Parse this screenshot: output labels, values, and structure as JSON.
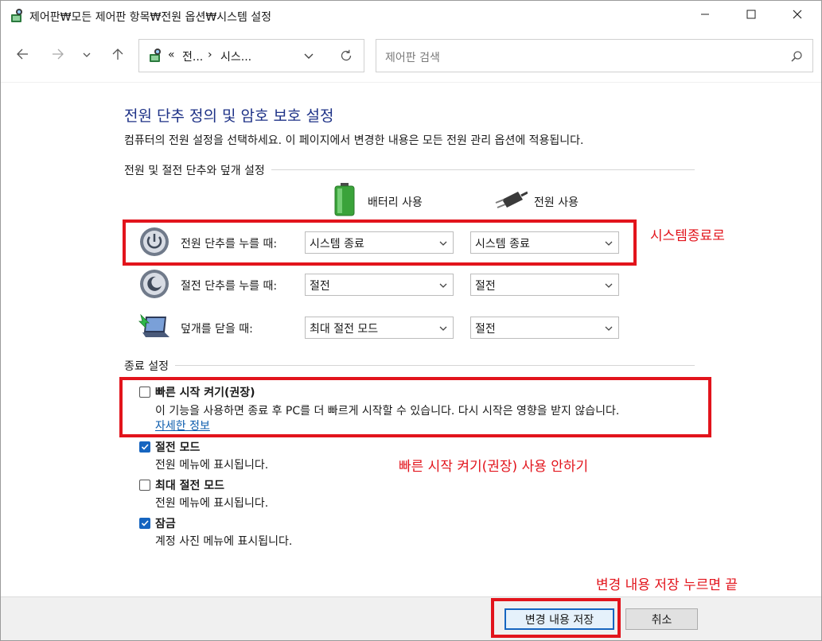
{
  "window": {
    "title": "제어판₩모든 제어판 항목₩전원 옵션₩시스템 설정"
  },
  "address": {
    "crumb_chevron": "«",
    "crumb1": "전...",
    "crumb_sep": "›",
    "crumb2": "시스..."
  },
  "search": {
    "placeholder": "제어판 검색"
  },
  "page": {
    "heading": "전원 단추 정의 및 암호 보호 설정",
    "subtitle": "컴퓨터의 전원 설정을 선택하세요. 이 페이지에서 변경한 내용은 모든 전원 관리 옵션에 적용됩니다."
  },
  "buttons_section": {
    "label": "전원 및 절전 단추와 덮개 설정",
    "col_battery": "배터리 사용",
    "col_plugged": "전원 사용",
    "rows": [
      {
        "label": "전원 단추를 누를 때:",
        "battery": "시스템 종료",
        "plugged": "시스템 종료",
        "icon": "power-icon"
      },
      {
        "label": "절전 단추를 누를 때:",
        "battery": "절전",
        "plugged": "절전",
        "icon": "sleep-icon"
      },
      {
        "label": "덮개를 닫을 때:",
        "battery": "최대 절전 모드",
        "plugged": "절전",
        "icon": "laptop-lid-icon"
      }
    ]
  },
  "shutdown_section": {
    "label": "종료 설정",
    "items": [
      {
        "title": "빠른 시작 켜기(권장)",
        "desc": "이 기능을 사용하면 종료 후 PC를 더 빠르게 시작할 수 있습니다. 다시 시작은 영향을 받지 않습니다.",
        "link": "자세한 정보",
        "checked": false
      },
      {
        "title": "절전 모드",
        "desc": "전원 메뉴에 표시됩니다.",
        "checked": true
      },
      {
        "title": "최대 절전 모드",
        "desc": "전원 메뉴에 표시됩니다.",
        "checked": false
      },
      {
        "title": "잠금",
        "desc": "계정 사진 메뉴에 표시됩니다.",
        "checked": true
      }
    ]
  },
  "annotations": {
    "power_button": "시스템종료로",
    "fast_startup": "빠른 시작 켜기(권장) 사용 안하기",
    "save": "변경 내용 저장 누르면 끝"
  },
  "footer": {
    "save": "변경 내용 저장",
    "cancel": "취소"
  },
  "colors": {
    "annotation_red": "#e2141c",
    "heading_blue": "#1e3287",
    "accent_blue": "#1665c0",
    "link_blue": "#0b5cad"
  }
}
